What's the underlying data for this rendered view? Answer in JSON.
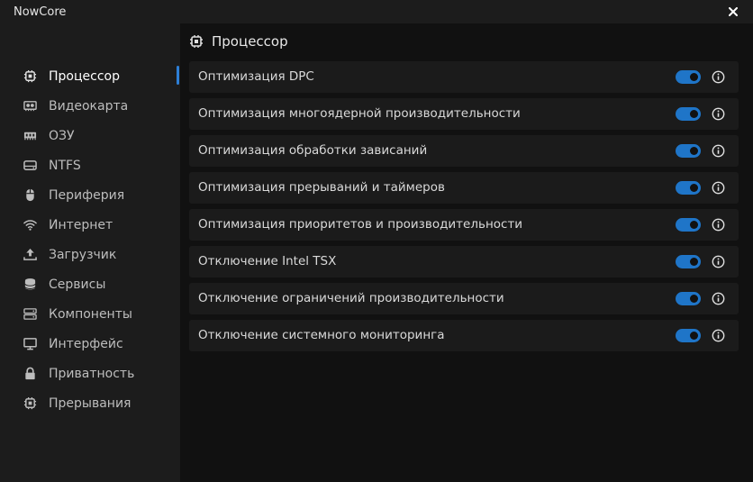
{
  "app": {
    "title": "NowCore"
  },
  "sidebar": {
    "items": [
      {
        "label": "Процессор",
        "icon": "cpu-icon",
        "active": true
      },
      {
        "label": "Видеокарта",
        "icon": "gpu-icon"
      },
      {
        "label": "ОЗУ",
        "icon": "ram-icon"
      },
      {
        "label": "NTFS",
        "icon": "drive-icon"
      },
      {
        "label": "Периферия",
        "icon": "mouse-icon"
      },
      {
        "label": "Интернет",
        "icon": "wifi-icon"
      },
      {
        "label": "Загрузчик",
        "icon": "boot-icon"
      },
      {
        "label": "Сервисы",
        "icon": "database-icon"
      },
      {
        "label": "Компоненты",
        "icon": "server-icon"
      },
      {
        "label": "Интерфейс",
        "icon": "monitor-icon"
      },
      {
        "label": "Приватность",
        "icon": "lock-icon"
      },
      {
        "label": "Прерывания",
        "icon": "chip-icon"
      }
    ]
  },
  "main": {
    "section_title": "Процессор",
    "section_icon": "cpu-icon",
    "settings": [
      {
        "label": "Оптимизация DPC",
        "enabled": true
      },
      {
        "label": "Оптимизация многоядерной производительности",
        "enabled": true
      },
      {
        "label": "Оптимизация обработки зависаний",
        "enabled": true
      },
      {
        "label": "Оптимизация прерываний и таймеров",
        "enabled": true
      },
      {
        "label": "Оптимизация приоритетов и производительности",
        "enabled": true
      },
      {
        "label": "Отключение Intel TSX",
        "enabled": true
      },
      {
        "label": "Отключение ограничений производительности",
        "enabled": true
      },
      {
        "label": "Отключение системного мониторинга",
        "enabled": true
      }
    ]
  },
  "colors": {
    "accent": "#1f75c8",
    "sidebar_bg": "#1c1c1c",
    "content_bg": "#111111",
    "row_bg": "#1b1b1b"
  }
}
